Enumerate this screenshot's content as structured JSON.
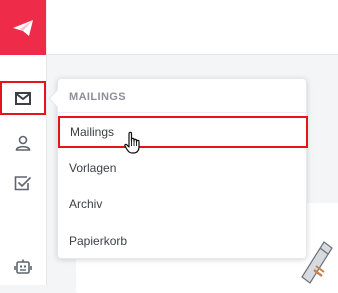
{
  "sidebar": {
    "logo_icon": "paper-plane-icon",
    "items": [
      {
        "name": "mailings",
        "icon": "envelope-icon"
      },
      {
        "name": "contacts",
        "icon": "user-icon"
      },
      {
        "name": "tasks",
        "icon": "checkbox-icon"
      },
      {
        "name": "automation",
        "icon": "robot-icon"
      }
    ]
  },
  "menu": {
    "header": "MAILINGS",
    "items": [
      {
        "label": "Mailings"
      },
      {
        "label": "Vorlagen"
      },
      {
        "label": "Archiv"
      },
      {
        "label": "Papierkorb"
      }
    ]
  },
  "colors": {
    "brand": "#ef2b4a",
    "highlight": "#e3141a",
    "icon": "#5f6570"
  }
}
